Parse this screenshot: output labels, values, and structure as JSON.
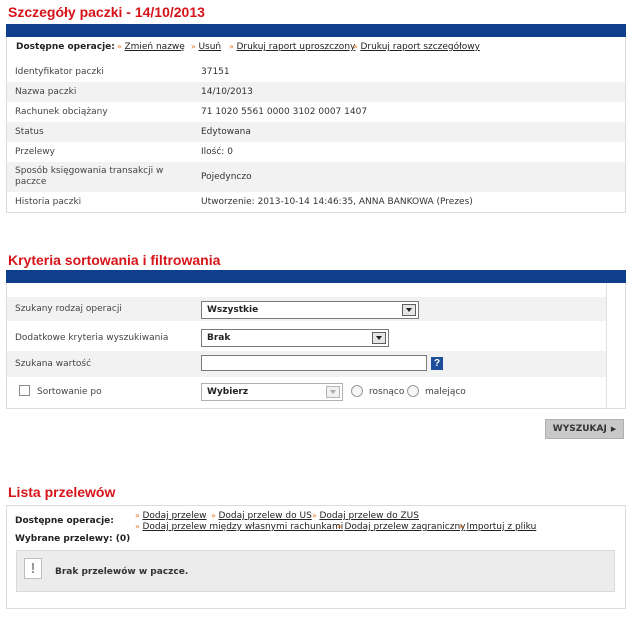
{
  "details": {
    "title": "Szczegóły paczki - 14/10/2013",
    "ops_label": "Dostępne operacje:",
    "ops": [
      {
        "label": "Zmień nazwę"
      },
      {
        "label": "Usuń"
      },
      {
        "label": "Drukuj raport uproszczony"
      },
      {
        "label": "Drukuj raport szczegółowy"
      }
    ],
    "rows": [
      {
        "label": "Identyfikator paczki",
        "value": "37151"
      },
      {
        "label": "Nazwa paczki",
        "value": "14/10/2013"
      },
      {
        "label": "Rachunek obciążany",
        "value": "71 1020 5561 0000 3102 0007 1407"
      },
      {
        "label": "Status",
        "value": "Edytowana"
      },
      {
        "label": "Przelewy",
        "value": "Ilość: 0"
      },
      {
        "label": "Sposób księgowania transakcji w paczce",
        "value": "Pojedynczo"
      },
      {
        "label": "Historia paczki",
        "value": "Utworzenie: 2013-10-14 14:46:35, ANNA BANKOWA (Prezes)"
      }
    ]
  },
  "filter": {
    "title": "Kryteria sortowania i filtrowania",
    "operation_type": {
      "label": "Szukany rodzaj operacji",
      "value": "Wszystkie"
    },
    "extra_criteria": {
      "label": "Dodatkowe kryteria wyszukiwania",
      "value": "Brak"
    },
    "search_value": {
      "label": "Szukana wartość",
      "value": "",
      "help": "?"
    },
    "sort": {
      "label": "Sortowanie po",
      "value": "Wybierz",
      "asc": "rosnąco",
      "desc": "malejąco"
    },
    "search_button": "WYSZUKAJ"
  },
  "transfers": {
    "title": "Lista przelewów",
    "ops_label": "Dostępne operacje:",
    "selected_label": "Wybrane przelewy: (0)",
    "ops_row1": [
      {
        "label": "Dodaj przelew"
      },
      {
        "label": "Dodaj przelew do US"
      },
      {
        "label": "Dodaj przelew do ZUS"
      }
    ],
    "ops_row2": [
      {
        "label": "Dodaj przelew między własnymi rachunkami"
      },
      {
        "label": "Dodaj przelew zagraniczny"
      },
      {
        "label": "Importuj z pliku"
      }
    ],
    "empty_icon": "!",
    "empty_message": "Brak przelewów w paczce."
  },
  "colors": {
    "title_red": "#d7141a",
    "header_blue": "#0f3f8c",
    "link_arrow": "#e07b2d",
    "row_alt": "#f2f2f2"
  }
}
